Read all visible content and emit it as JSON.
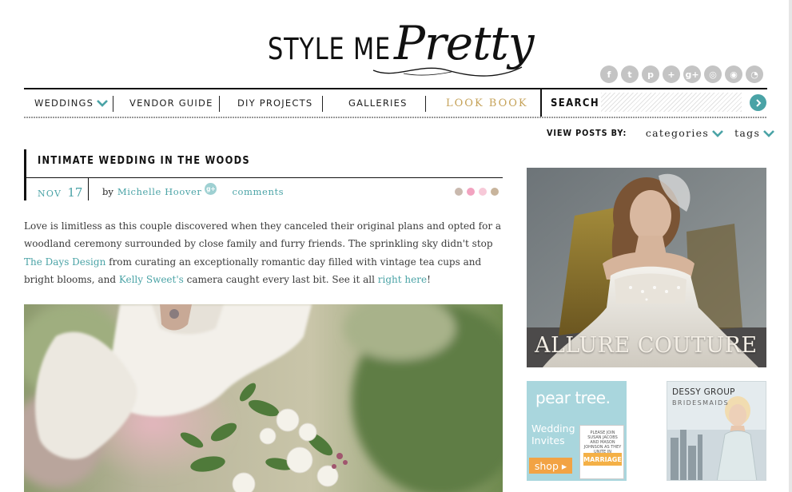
{
  "header": {
    "logo": {
      "style_me": "STYLE ME",
      "pretty": "Pretty"
    },
    "social": [
      {
        "name": "facebook",
        "glyph": "f"
      },
      {
        "name": "twitter",
        "glyph": "t"
      },
      {
        "name": "pinterest",
        "glyph": "p"
      },
      {
        "name": "plus",
        "glyph": "+"
      },
      {
        "name": "google-plus",
        "glyph": "g+"
      },
      {
        "name": "instagram",
        "glyph": "◎"
      },
      {
        "name": "bloglovin",
        "glyph": "◉"
      },
      {
        "name": "rss",
        "glyph": "◔"
      }
    ]
  },
  "nav": {
    "items": [
      "WEDDINGS",
      "VENDOR GUIDE",
      "DIY PROJECTS",
      "GALLERIES",
      "LOOK BOOK"
    ],
    "search_label": "SEARCH",
    "search_placeholder": ""
  },
  "view_posts": {
    "label": "VIEW POSTS BY:",
    "options": [
      "categories",
      "tags"
    ]
  },
  "post": {
    "title": "INTIMATE WEDDING IN THE WOODS",
    "date_month": "NOV",
    "date_day": "17",
    "by": "by",
    "author": "Michelle Hoover",
    "gplus": "g+",
    "comments": "comments",
    "body_1": "Love is limitless as this couple discovered when they canceled their original plans and opted for a woodland ceremony surrounded by close family and furry friends. The sprinkling sky didn't stop ",
    "link_1": "The Days Design",
    "body_2": " from curating an exceptionally romantic day filled with vintage tea cups and bright blooms, and ",
    "link_2": "Kelly Sweet's",
    "body_3": " camera caught every last bit. See it all ",
    "link_3": "right here",
    "body_4": "!",
    "dot_colors": [
      "#c9b9ae",
      "#f2a3c0",
      "#f7c9d8",
      "#c8b49c"
    ]
  },
  "sidebar": {
    "ad_allure": "ALLURE COUTURE",
    "ad_peartree": {
      "logo": "pear tree.",
      "sub": "Wedding Invites",
      "shop": "shop ▸",
      "card_text": "PLEASE JOIN SUSAN JACOBS AND MASON JOHNSON AS THEY UNITE IN",
      "card_marriage": "MARRIAGE"
    },
    "ad_dessy": {
      "brand": "DESSY GROUP",
      "sub": "BRIDESMAIDS"
    }
  },
  "colors": {
    "accent": "#4aa3a6",
    "lookbook": "#c6a35a",
    "text": "#3a3a3a"
  }
}
